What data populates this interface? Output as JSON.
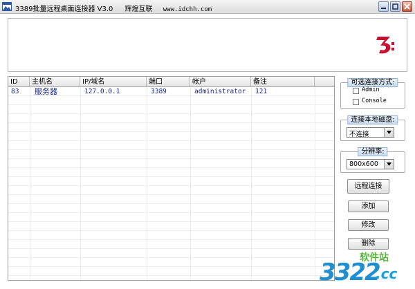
{
  "window": {
    "title": "3389批量远程桌面连接器 V3.0",
    "subtitle": "辉煌互联",
    "url": "www.idchh.com"
  },
  "table": {
    "columns": [
      "ID",
      "主机名",
      "IP/域名",
      "端口",
      "帐户",
      "备注"
    ],
    "rows": [
      [
        "83",
        "服务器",
        "127.0.0.1",
        "3389",
        "administrator",
        "121"
      ]
    ]
  },
  "options": {
    "title": "可选连接方式:",
    "admin_label": "Admin",
    "console_label": "Console"
  },
  "local_disk": {
    "title": "连接本地磁盘:",
    "selected": "不连接"
  },
  "resolution": {
    "title": "分辨率:",
    "selected": "800x600"
  },
  "buttons": {
    "connect": "远程连接",
    "add": "添加",
    "edit": "修改",
    "delete": "删除"
  },
  "watermark": {
    "digits": "3322",
    "suffix": ".cc",
    "site": "软件站"
  },
  "colors": {
    "row_text": "#1a2a8a",
    "group_title_bg": "#c9dcf0",
    "logo_red": "#c8102e"
  }
}
